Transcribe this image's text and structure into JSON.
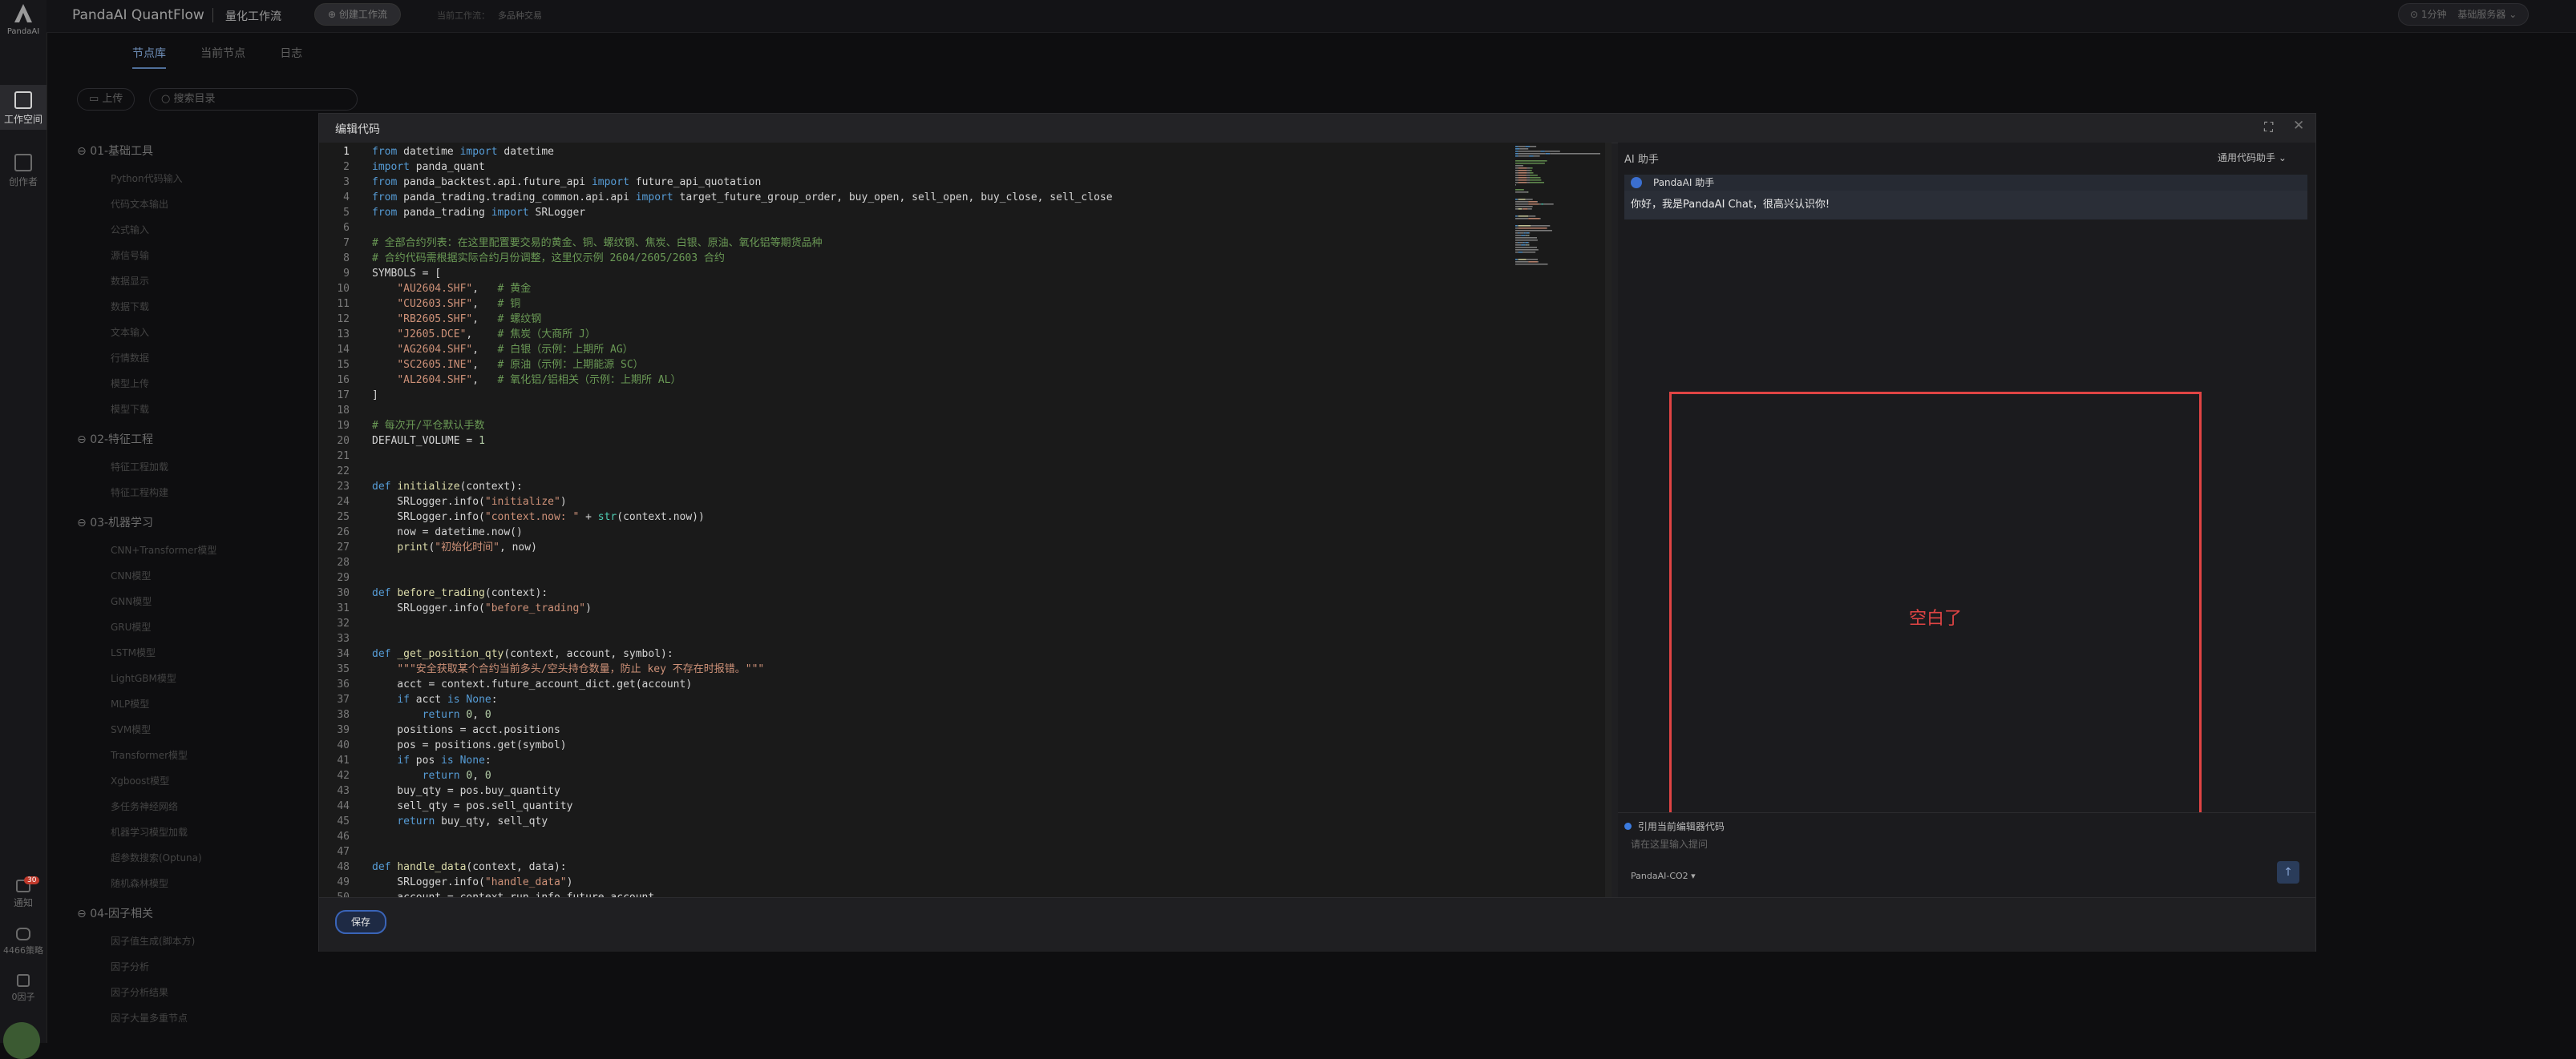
{
  "app": {
    "logo_text": "PandaAI",
    "title": "PandaAI QuantFlow",
    "section": "量化工作流",
    "create_button": "创建工作流",
    "current_workflow_label": "当前工作流：",
    "current_workflow_name": "多品种交易",
    "interval_label": "1分钟",
    "server_label": "基础服务器"
  },
  "rail": {
    "workspace": "工作空间",
    "creator": "创作者",
    "notifications": "通知",
    "notif_count": "30",
    "market": "4466策略",
    "factors": "0因子"
  },
  "tabs": [
    "节点库",
    "当前节点",
    "日志"
  ],
  "library": {
    "upload": "上传",
    "search_placeholder": "搜索目录",
    "groups": [
      {
        "name": "01-基础工具",
        "items": [
          "Python代码输入",
          "代码文本输出",
          "公式输入",
          "源信号输",
          "数据显示",
          "数据下载",
          "文本输入",
          "行情数据",
          "模型上传",
          "模型下载"
        ]
      },
      {
        "name": "02-特征工程",
        "items": [
          "特征工程加载",
          "特征工程构建"
        ]
      },
      {
        "name": "03-机器学习",
        "items": [
          "CNN+Transformer模型",
          "CNN模型",
          "GNN模型",
          "GRU模型",
          "LSTM模型",
          "LightGBM模型",
          "MLP模型",
          "SVM模型",
          "Transformer模型",
          "Xgboost模型",
          "多任务神经网络",
          "机器学习模型加载",
          "超参数搜索(Optuna)",
          "随机森林模型"
        ]
      },
      {
        "name": "04-因子相关",
        "items": [
          "因子值生成(脚本方)",
          "因子分析",
          "因子分析结果",
          "因子大量多重节点"
        ]
      }
    ]
  },
  "modal": {
    "title": "编辑代码",
    "save_label": "保存"
  },
  "code": [
    [
      {
        "t": "kw",
        "v": "from"
      },
      {
        "t": "p",
        "v": " datetime "
      },
      {
        "t": "kw",
        "v": "import"
      },
      {
        "t": "p",
        "v": " datetime"
      }
    ],
    [
      {
        "t": "kw",
        "v": "import"
      },
      {
        "t": "p",
        "v": " panda_quant"
      }
    ],
    [
      {
        "t": "kw",
        "v": "from"
      },
      {
        "t": "p",
        "v": " panda_backtest.api.future_api "
      },
      {
        "t": "kw",
        "v": "import"
      },
      {
        "t": "p",
        "v": " future_api_quotation"
      }
    ],
    [
      {
        "t": "kw",
        "v": "from"
      },
      {
        "t": "p",
        "v": " panda_trading.trading_common.api.api "
      },
      {
        "t": "kw",
        "v": "import"
      },
      {
        "t": "p",
        "v": " target_future_group_order, buy_open, sell_open, buy_close, sell_close"
      }
    ],
    [
      {
        "t": "kw",
        "v": "from"
      },
      {
        "t": "p",
        "v": " panda_trading "
      },
      {
        "t": "kw",
        "v": "import"
      },
      {
        "t": "p",
        "v": " SRLogger"
      }
    ],
    [],
    [
      {
        "t": "cm",
        "v": "# 全部合约列表：在这里配置要交易的黄金、铜、螺纹钢、焦炭、白银、原油、氧化铝等期货品种"
      }
    ],
    [
      {
        "t": "cm",
        "v": "# 合约代码需根据实际合约月份调整，这里仅示例 2604/2605/2603 合约"
      }
    ],
    [
      {
        "t": "p",
        "v": "SYMBOLS = ["
      }
    ],
    [
      {
        "t": "p",
        "v": "    "
      },
      {
        "t": "str",
        "v": "\"AU2604.SHF\""
      },
      {
        "t": "p",
        "v": ",   "
      },
      {
        "t": "cm",
        "v": "# 黄金"
      }
    ],
    [
      {
        "t": "p",
        "v": "    "
      },
      {
        "t": "str",
        "v": "\"CU2603.SHF\""
      },
      {
        "t": "p",
        "v": ",   "
      },
      {
        "t": "cm",
        "v": "# 铜"
      }
    ],
    [
      {
        "t": "p",
        "v": "    "
      },
      {
        "t": "str",
        "v": "\"RB2605.SHF\""
      },
      {
        "t": "p",
        "v": ",   "
      },
      {
        "t": "cm",
        "v": "# 螺纹钢"
      }
    ],
    [
      {
        "t": "p",
        "v": "    "
      },
      {
        "t": "str",
        "v": "\"J2605.DCE\""
      },
      {
        "t": "p",
        "v": ",    "
      },
      {
        "t": "cm",
        "v": "# 焦炭（大商所 J）"
      }
    ],
    [
      {
        "t": "p",
        "v": "    "
      },
      {
        "t": "str",
        "v": "\"AG2604.SHF\""
      },
      {
        "t": "p",
        "v": ",   "
      },
      {
        "t": "cm",
        "v": "# 白银（示例：上期所 AG）"
      }
    ],
    [
      {
        "t": "p",
        "v": "    "
      },
      {
        "t": "str",
        "v": "\"SC2605.INE\""
      },
      {
        "t": "p",
        "v": ",   "
      },
      {
        "t": "cm",
        "v": "# 原油（示例：上期能源 SC）"
      }
    ],
    [
      {
        "t": "p",
        "v": "    "
      },
      {
        "t": "str",
        "v": "\"AL2604.SHF\""
      },
      {
        "t": "p",
        "v": ",   "
      },
      {
        "t": "cm",
        "v": "# 氧化铝/铝相关（示例：上期所 AL）"
      }
    ],
    [
      {
        "t": "p",
        "v": "]"
      }
    ],
    [],
    [
      {
        "t": "cm",
        "v": "# 每次开/平仓默认手数"
      }
    ],
    [
      {
        "t": "p",
        "v": "DEFAULT_VOLUME = "
      },
      {
        "t": "num",
        "v": "1"
      }
    ],
    [],
    [],
    [
      {
        "t": "kw",
        "v": "def"
      },
      {
        "t": "p",
        "v": " "
      },
      {
        "t": "fn",
        "v": "initialize"
      },
      {
        "t": "p",
        "v": "(context):"
      }
    ],
    [
      {
        "t": "p",
        "v": "    SRLogger.info("
      },
      {
        "t": "str",
        "v": "\"initialize\""
      },
      {
        "t": "p",
        "v": ")"
      }
    ],
    [
      {
        "t": "p",
        "v": "    SRLogger.info("
      },
      {
        "t": "str",
        "v": "\"context.now: \""
      },
      {
        "t": "p",
        "v": " + "
      },
      {
        "t": "tr",
        "v": "str"
      },
      {
        "t": "p",
        "v": "(context.now))"
      }
    ],
    [
      {
        "t": "p",
        "v": "    now = datetime.now()"
      }
    ],
    [
      {
        "t": "p",
        "v": "    "
      },
      {
        "t": "fn",
        "v": "print"
      },
      {
        "t": "p",
        "v": "("
      },
      {
        "t": "str",
        "v": "\"初始化时间\""
      },
      {
        "t": "p",
        "v": ", now)"
      }
    ],
    [],
    [],
    [
      {
        "t": "kw",
        "v": "def"
      },
      {
        "t": "p",
        "v": " "
      },
      {
        "t": "fn",
        "v": "before_trading"
      },
      {
        "t": "p",
        "v": "(context):"
      }
    ],
    [
      {
        "t": "p",
        "v": "    SRLogger.info("
      },
      {
        "t": "str",
        "v": "\"before_trading\""
      },
      {
        "t": "p",
        "v": ")"
      }
    ],
    [],
    [],
    [
      {
        "t": "kw",
        "v": "def"
      },
      {
        "t": "p",
        "v": " "
      },
      {
        "t": "fn",
        "v": "_get_position_qty"
      },
      {
        "t": "p",
        "v": "(context, account, symbol):"
      }
    ],
    [
      {
        "t": "p",
        "v": "    "
      },
      {
        "t": "str",
        "v": "\"\"\"安全获取某个合约当前多头/空头持仓数量，防止 key 不存在时报错。\"\"\""
      }
    ],
    [
      {
        "t": "p",
        "v": "    acct = context.future_account_dict.get(account)"
      }
    ],
    [
      {
        "t": "p",
        "v": "    "
      },
      {
        "t": "kw",
        "v": "if"
      },
      {
        "t": "p",
        "v": " acct "
      },
      {
        "t": "kw",
        "v": "is"
      },
      {
        "t": "p",
        "v": " "
      },
      {
        "t": "kw",
        "v": "None"
      },
      {
        "t": "p",
        "v": ":"
      }
    ],
    [
      {
        "t": "p",
        "v": "        "
      },
      {
        "t": "kw",
        "v": "return"
      },
      {
        "t": "p",
        "v": " "
      },
      {
        "t": "num",
        "v": "0"
      },
      {
        "t": "p",
        "v": ", "
      },
      {
        "t": "num",
        "v": "0"
      }
    ],
    [
      {
        "t": "p",
        "v": "    positions = acct.positions"
      }
    ],
    [
      {
        "t": "p",
        "v": "    pos = positions.get(symbol)"
      }
    ],
    [
      {
        "t": "p",
        "v": "    "
      },
      {
        "t": "kw",
        "v": "if"
      },
      {
        "t": "p",
        "v": " pos "
      },
      {
        "t": "kw",
        "v": "is"
      },
      {
        "t": "p",
        "v": " "
      },
      {
        "t": "kw",
        "v": "None"
      },
      {
        "t": "p",
        "v": ":"
      }
    ],
    [
      {
        "t": "p",
        "v": "        "
      },
      {
        "t": "kw",
        "v": "return"
      },
      {
        "t": "p",
        "v": " "
      },
      {
        "t": "num",
        "v": "0"
      },
      {
        "t": "p",
        "v": ", "
      },
      {
        "t": "num",
        "v": "0"
      }
    ],
    [
      {
        "t": "p",
        "v": "    buy_qty = pos.buy_quantity"
      }
    ],
    [
      {
        "t": "p",
        "v": "    sell_qty = pos.sell_quantity"
      }
    ],
    [
      {
        "t": "p",
        "v": "    "
      },
      {
        "t": "kw",
        "v": "return"
      },
      {
        "t": "p",
        "v": " buy_qty, sell_qty"
      }
    ],
    [],
    [],
    [
      {
        "t": "kw",
        "v": "def"
      },
      {
        "t": "p",
        "v": " "
      },
      {
        "t": "fn",
        "v": "handle_data"
      },
      {
        "t": "p",
        "v": "(context, data):"
      }
    ],
    [
      {
        "t": "p",
        "v": "    SRLogger.info("
      },
      {
        "t": "str",
        "v": "\"handle_data\""
      },
      {
        "t": "p",
        "v": ")"
      }
    ],
    [
      {
        "t": "p",
        "v": "    account = context.run_info.future_account"
      }
    ]
  ],
  "ai": {
    "header": "AI 助手",
    "mode": "通用代码助手",
    "bot_name": "PandaAI 助手",
    "greeting": "你好，我是PandaAI Chat，很高兴认识你!",
    "annotation": "空白了",
    "use_code_label": "引用当前编辑器代码",
    "input_placeholder": "请在这里输入提问",
    "model": "PandaAI-CO2"
  }
}
